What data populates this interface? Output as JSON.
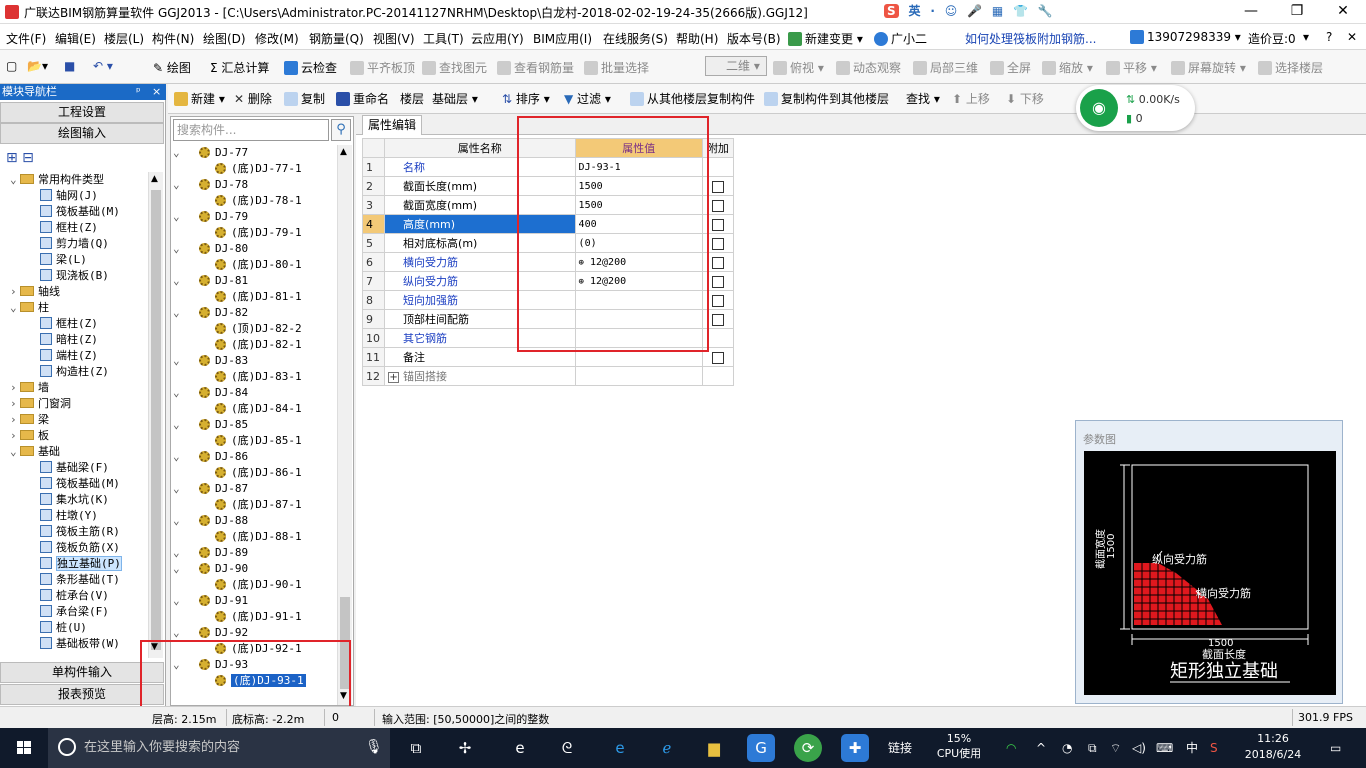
{
  "window": {
    "title": "广联达BIM钢筋算量软件 GGJ2013 - [C:\\Users\\Administrator.PC-20141127NRHM\\Desktop\\白龙村-2018-02-02-19-24-35(2666版).GGJ12]",
    "ime_items": [
      "S",
      "英",
      "·",
      "☺",
      "🎤",
      "▦",
      "👕",
      "🔧"
    ]
  },
  "menu": {
    "items": [
      "文件(F)",
      "编辑(E)",
      "楼层(L)",
      "构件(N)",
      "绘图(D)",
      "修改(M)",
      "钢筋量(Q)",
      "视图(V)",
      "工具(T)",
      "云应用(Y)",
      "BIM应用(I)",
      "在线服务(S)",
      "帮助(H)",
      "版本号(B)"
    ],
    "new_change": "新建变更",
    "guangxiaoer": "广小二",
    "help_link": "如何处理筏板附加钢筋...",
    "phone": "13907298339",
    "credits": "造价豆:0"
  },
  "toolbar1": {
    "draw": "绘图",
    "sum": "汇总计算",
    "cloud_check": "云检查",
    "align_slab": "平齐板顶",
    "find_elem": "查找图元",
    "view_rebar": "查看钢筋量",
    "batch_select": "批量选择",
    "view_mode": "二维",
    "top_view": "俯视",
    "dynamic_view": "动态观察",
    "local_3d": "局部三维",
    "fullscreen": "全屏",
    "zoom": "缩放",
    "pan": "平移",
    "rotate": "屏幕旋转",
    "select_floor": "选择楼层"
  },
  "toolbar2": {
    "new": "新建",
    "delete": "删除",
    "copy": "复制",
    "rename": "重命名",
    "floor_label": "楼层",
    "floor_value": "基础层",
    "sort": "排序",
    "filter": "过滤",
    "copy_from": "从其他楼层复制构件",
    "copy_to": "复制构件到其他楼层",
    "find": "查找",
    "up": "上移",
    "down": "下移"
  },
  "network": {
    "speed": "0.00K/s",
    "count": "0"
  },
  "nav": {
    "header": "模块导航栏",
    "pin": "ᵖ",
    "close": "×",
    "project_settings": "工程设置",
    "drawing_input": "绘图输入",
    "single_input": "单构件输入",
    "report_preview": "报表预览",
    "tree": [
      {
        "exp": "⌄",
        "type": "folder",
        "label": "常用构件类型",
        "level": 0
      },
      {
        "exp": "",
        "type": "icon",
        "label": "轴网(J)",
        "level": 1
      },
      {
        "exp": "",
        "type": "icon",
        "label": "筏板基础(M)",
        "level": 1
      },
      {
        "exp": "",
        "type": "icon",
        "label": "框柱(Z)",
        "level": 1
      },
      {
        "exp": "",
        "type": "icon",
        "label": "剪力墙(Q)",
        "level": 1
      },
      {
        "exp": "",
        "type": "icon",
        "label": "梁(L)",
        "level": 1
      },
      {
        "exp": "",
        "type": "icon",
        "label": "现浇板(B)",
        "level": 1
      },
      {
        "exp": "›",
        "type": "folder",
        "label": "轴线",
        "level": 0
      },
      {
        "exp": "⌄",
        "type": "folder",
        "label": "柱",
        "level": 0
      },
      {
        "exp": "",
        "type": "icon",
        "label": "框柱(Z)",
        "level": 1
      },
      {
        "exp": "",
        "type": "icon",
        "label": "暗柱(Z)",
        "level": 1
      },
      {
        "exp": "",
        "type": "icon",
        "label": "端柱(Z)",
        "level": 1
      },
      {
        "exp": "",
        "type": "icon",
        "label": "构造柱(Z)",
        "level": 1
      },
      {
        "exp": "›",
        "type": "folder",
        "label": "墙",
        "level": 0
      },
      {
        "exp": "›",
        "type": "folder",
        "label": "门窗洞",
        "level": 0
      },
      {
        "exp": "›",
        "type": "folder",
        "label": "梁",
        "level": 0
      },
      {
        "exp": "›",
        "type": "folder",
        "label": "板",
        "level": 0
      },
      {
        "exp": "⌄",
        "type": "folder",
        "label": "基础",
        "level": 0
      },
      {
        "exp": "",
        "type": "icon",
        "label": "基础梁(F)",
        "level": 1
      },
      {
        "exp": "",
        "type": "icon",
        "label": "筏板基础(M)",
        "level": 1
      },
      {
        "exp": "",
        "type": "icon",
        "label": "集水坑(K)",
        "level": 1
      },
      {
        "exp": "",
        "type": "icon",
        "label": "柱墩(Y)",
        "level": 1
      },
      {
        "exp": "",
        "type": "icon",
        "label": "筏板主筋(R)",
        "level": 1
      },
      {
        "exp": "",
        "type": "icon",
        "label": "筏板负筋(X)",
        "level": 1
      },
      {
        "exp": "",
        "type": "icon",
        "label": "独立基础(P)",
        "level": 1,
        "selected": true
      },
      {
        "exp": "",
        "type": "icon",
        "label": "条形基础(T)",
        "level": 1
      },
      {
        "exp": "",
        "type": "icon",
        "label": "桩承台(V)",
        "level": 1
      },
      {
        "exp": "",
        "type": "icon",
        "label": "承台梁(F)",
        "level": 1
      },
      {
        "exp": "",
        "type": "icon",
        "label": "桩(U)",
        "level": 1
      },
      {
        "exp": "",
        "type": "icon",
        "label": "基础板带(W)",
        "level": 1
      }
    ]
  },
  "components": {
    "search_placeholder": "搜索构件...",
    "rows": [
      {
        "level": 0,
        "label": "DJ-77"
      },
      {
        "level": 1,
        "label": "(底)DJ-77-1"
      },
      {
        "level": 0,
        "label": "DJ-78"
      },
      {
        "level": 1,
        "label": "(底)DJ-78-1"
      },
      {
        "level": 0,
        "label": "DJ-79"
      },
      {
        "level": 1,
        "label": "(底)DJ-79-1"
      },
      {
        "level": 0,
        "label": "DJ-80"
      },
      {
        "level": 1,
        "label": "(底)DJ-80-1"
      },
      {
        "level": 0,
        "label": "DJ-81"
      },
      {
        "level": 1,
        "label": "(底)DJ-81-1"
      },
      {
        "level": 0,
        "label": "DJ-82"
      },
      {
        "level": 1,
        "label": "(顶)DJ-82-2"
      },
      {
        "level": 1,
        "label": "(底)DJ-82-1"
      },
      {
        "level": 0,
        "label": "DJ-83"
      },
      {
        "level": 1,
        "label": "(底)DJ-83-1"
      },
      {
        "level": 0,
        "label": "DJ-84"
      },
      {
        "level": 1,
        "label": "(底)DJ-84-1"
      },
      {
        "level": 0,
        "label": "DJ-85"
      },
      {
        "level": 1,
        "label": "(底)DJ-85-1"
      },
      {
        "level": 0,
        "label": "DJ-86"
      },
      {
        "level": 1,
        "label": "(底)DJ-86-1"
      },
      {
        "level": 0,
        "label": "DJ-87"
      },
      {
        "level": 1,
        "label": "(底)DJ-87-1"
      },
      {
        "level": 0,
        "label": "DJ-88"
      },
      {
        "level": 1,
        "label": "(底)DJ-88-1"
      },
      {
        "level": 0,
        "label": "DJ-89"
      },
      {
        "level": 0,
        "label": "DJ-90"
      },
      {
        "level": 1,
        "label": "(底)DJ-90-1"
      },
      {
        "level": 0,
        "label": "DJ-91"
      },
      {
        "level": 1,
        "label": "(底)DJ-91-1"
      },
      {
        "level": 0,
        "label": "DJ-92"
      },
      {
        "level": 1,
        "label": "(底)DJ-92-1"
      },
      {
        "level": 0,
        "label": "DJ-93"
      },
      {
        "level": 1,
        "label": "(底)DJ-93-1",
        "selected": true
      }
    ]
  },
  "props": {
    "tab": "属性编辑",
    "headers": {
      "name": "属性名称",
      "value": "属性值",
      "extra": "附加"
    },
    "rows": [
      {
        "n": "1",
        "name": "名称",
        "value": "DJ-93-1",
        "blue": true,
        "check": false
      },
      {
        "n": "2",
        "name": "截面长度(mm)",
        "value": "1500",
        "blue": false,
        "check": true
      },
      {
        "n": "3",
        "name": "截面宽度(mm)",
        "value": "1500",
        "blue": false,
        "check": true
      },
      {
        "n": "4",
        "name": "高度(mm)",
        "value": "400",
        "blue": true,
        "check": true,
        "selected": true
      },
      {
        "n": "5",
        "name": "相对底标高(m)",
        "value": "(0)",
        "blue": false,
        "check": true
      },
      {
        "n": "6",
        "name": "横向受力筋",
        "value": " 12@200",
        "blue": true,
        "check": true
      },
      {
        "n": "7",
        "name": "纵向受力筋",
        "value": " 12@200",
        "blue": true,
        "check": true
      },
      {
        "n": "8",
        "name": "短向加强筋",
        "value": "",
        "blue": true,
        "check": true
      },
      {
        "n": "9",
        "name": "顶部柱间配筋",
        "value": "",
        "blue": false,
        "check": true
      },
      {
        "n": "10",
        "name": "其它钢筋",
        "value": "",
        "blue": true,
        "check": false
      },
      {
        "n": "11",
        "name": "备注",
        "value": "",
        "blue": false,
        "check": true
      },
      {
        "n": "12",
        "name": "锚固搭接",
        "value": "",
        "blue": false,
        "check": false,
        "expander": true
      }
    ]
  },
  "param_diagram": {
    "title": "参数图",
    "dim_width": "1500",
    "label_width_axis": "截面宽度",
    "dim_length": "1500",
    "label_length_axis": "截面长度",
    "label_long_bar": "纵向受力筋",
    "label_trans_bar": "横向受力筋",
    "caption": "矩形独立基础"
  },
  "status": {
    "floor_height": "层高: 2.15m",
    "bottom_elev": "底标高: -2.2m",
    "zero": "0",
    "hint": "输入范围: [50,50000]之间的整数",
    "fps": "301.9 FPS"
  },
  "taskbar": {
    "search_placeholder": "在这里输入你要搜索的内容",
    "link": "链接",
    "cpu_pct": "15%",
    "cpu_label": "CPU使用",
    "lang": "中",
    "time": "11:26",
    "date": "2018/6/24"
  }
}
